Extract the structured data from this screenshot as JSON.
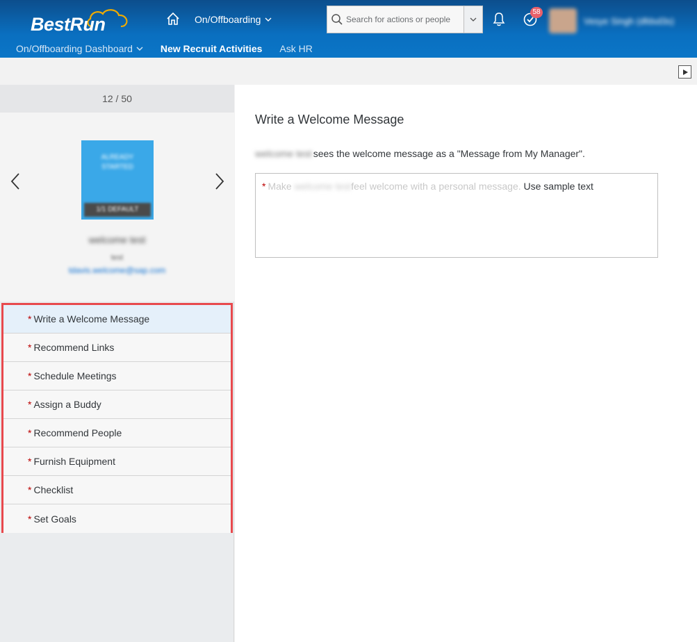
{
  "header": {
    "logo_text": "BestRun",
    "menu_title": "On/Offboarding",
    "subnav": [
      {
        "label": "On/Offboarding Dashboard"
      },
      {
        "label": "New Recruit Activities"
      },
      {
        "label": "Ask HR"
      }
    ],
    "search_placeholder": "Search for actions or people",
    "todo_badge": "58",
    "user_name": "Vesye Singh (dfdsd3s)"
  },
  "left_panel": {
    "counter": "12 / 50",
    "profile": {
      "photo_label": "ALREADY STARTED",
      "photo_tag": "1/1 DEFAULT",
      "name": "welcome test",
      "title": "test",
      "email": "tdavis.welcome@sap.com"
    },
    "tasks": [
      {
        "label": "Write a Welcome Message",
        "required": "*"
      },
      {
        "label": "Recommend Links",
        "required": "*"
      },
      {
        "label": "Schedule Meetings",
        "required": "*"
      },
      {
        "label": "Assign a Buddy",
        "required": "*"
      },
      {
        "label": "Recommend People",
        "required": "*"
      },
      {
        "label": "Furnish Equipment",
        "required": "*"
      },
      {
        "label": "Checklist",
        "required": "*"
      },
      {
        "label": "Set Goals",
        "required": "*"
      }
    ]
  },
  "content": {
    "title": "Write a Welcome Message",
    "desc_name": "welcome test",
    "desc_text": "sees the welcome message as a \"Message from My Manager\".",
    "message": {
      "required": "*",
      "ph_prefix": "Make",
      "ph_name": "welcome test",
      "ph_suffix": "feel welcome with a personal message.",
      "sample_link": "Use sample text"
    }
  },
  "colors": {
    "header_top": "#0c4e8c",
    "header_bottom": "#0b76c7",
    "highlight_border": "#e8494d",
    "selected_task": "#e5f0fa",
    "required_star": "#bb0000"
  }
}
